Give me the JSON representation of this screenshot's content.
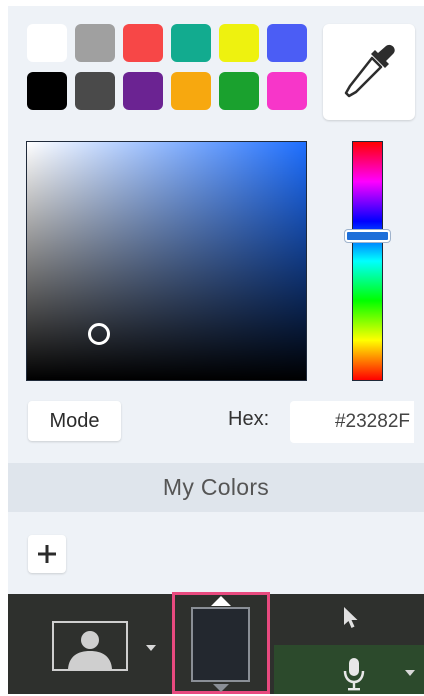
{
  "colors": {
    "swatch_row_1": [
      "#ffffff",
      "#a0a0a0",
      "#f74747",
      "#12ab8f",
      "#eef20f",
      "#4b5df5"
    ],
    "swatch_row_2": [
      "#000000",
      "#4a4a4a",
      "#6b2392",
      "#f7a80f",
      "#1aa12e",
      "#f736c9"
    ],
    "selected_color": "#23282F",
    "sv_area_hue": "#1e6fff",
    "highlight_border": "#e84a7f"
  },
  "picker": {
    "mode_label": "Mode",
    "hex_label": "Hex:",
    "hex_value": "#23282F",
    "hue_level": 0.41
  },
  "my_colors": {
    "title": "My Colors"
  },
  "icons": {
    "eyedropper": "eyedropper-icon",
    "add": "plus-icon",
    "camera": "person-silhouette-icon",
    "cursor": "arrow-cursor-icon",
    "mic": "microphone-icon"
  }
}
